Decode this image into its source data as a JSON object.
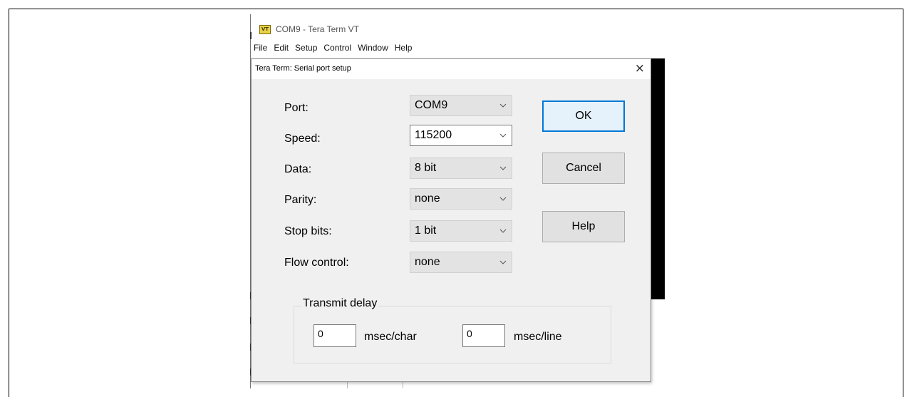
{
  "window": {
    "title": "COM9 - Tera Term VT",
    "icon": "vt-terminal-icon",
    "icon_label": "VT"
  },
  "menubar": [
    "File",
    "Edit",
    "Setup",
    "Control",
    "Window",
    "Help"
  ],
  "dialog": {
    "title": "Tera Term: Serial port setup",
    "close_glyph": "×",
    "fields": {
      "port": {
        "label": "Port:",
        "value": "COM9"
      },
      "speed": {
        "label": "Speed:",
        "value": "115200"
      },
      "data": {
        "label": "Data:",
        "value": "8 bit"
      },
      "parity": {
        "label": "Parity:",
        "value": "none"
      },
      "stop_bits": {
        "label": "Stop bits:",
        "value": "1 bit"
      },
      "flow_control": {
        "label": "Flow control:",
        "value": "none"
      }
    },
    "buttons": {
      "ok": "OK",
      "cancel": "Cancel",
      "help": "Help"
    },
    "transmit_delay": {
      "legend": "Transmit delay",
      "char_value": "0",
      "char_unit": "msec/char",
      "line_value": "0",
      "line_unit": "msec/line"
    }
  },
  "colors": {
    "default_button_border": "#0078d7",
    "dialog_bg": "#f0f0f0"
  }
}
